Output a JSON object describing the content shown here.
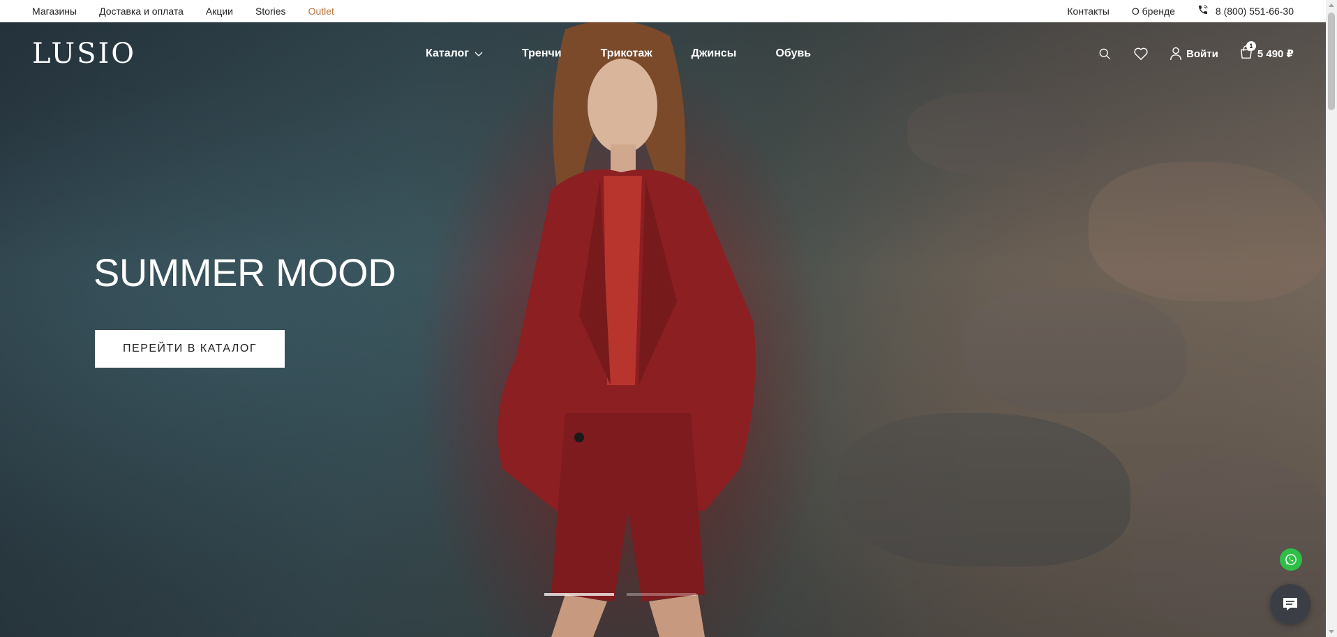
{
  "topbar": {
    "left_links": [
      "Магазины",
      "Доставка и оплата",
      "Акции",
      "Stories",
      "Outlet"
    ],
    "right_links": [
      "Контакты",
      "О бренде"
    ],
    "phone": "8 (800) 551-66-30"
  },
  "header": {
    "logo": "LUSIO",
    "menu": [
      "Каталог",
      "Тренчи",
      "Трикотаж",
      "Джинсы",
      "Обувь"
    ],
    "login_label": "Войти",
    "cart_total": "5 490 ₽",
    "cart_count": "1"
  },
  "hero": {
    "title": "SUMMER MOOD",
    "cta_label": "ПЕРЕЙТИ В КАТАЛОГ",
    "slides_total": 2,
    "active_slide": 1
  },
  "colors": {
    "outlet": "#b8743b",
    "whatsapp": "#2fbf49",
    "chat_bubble": "#3b3f45"
  },
  "icons": [
    "phone-icon",
    "chevron-down-icon",
    "search-icon",
    "heart-icon",
    "user-icon",
    "cart-icon",
    "whatsapp-icon",
    "chat-icon"
  ]
}
